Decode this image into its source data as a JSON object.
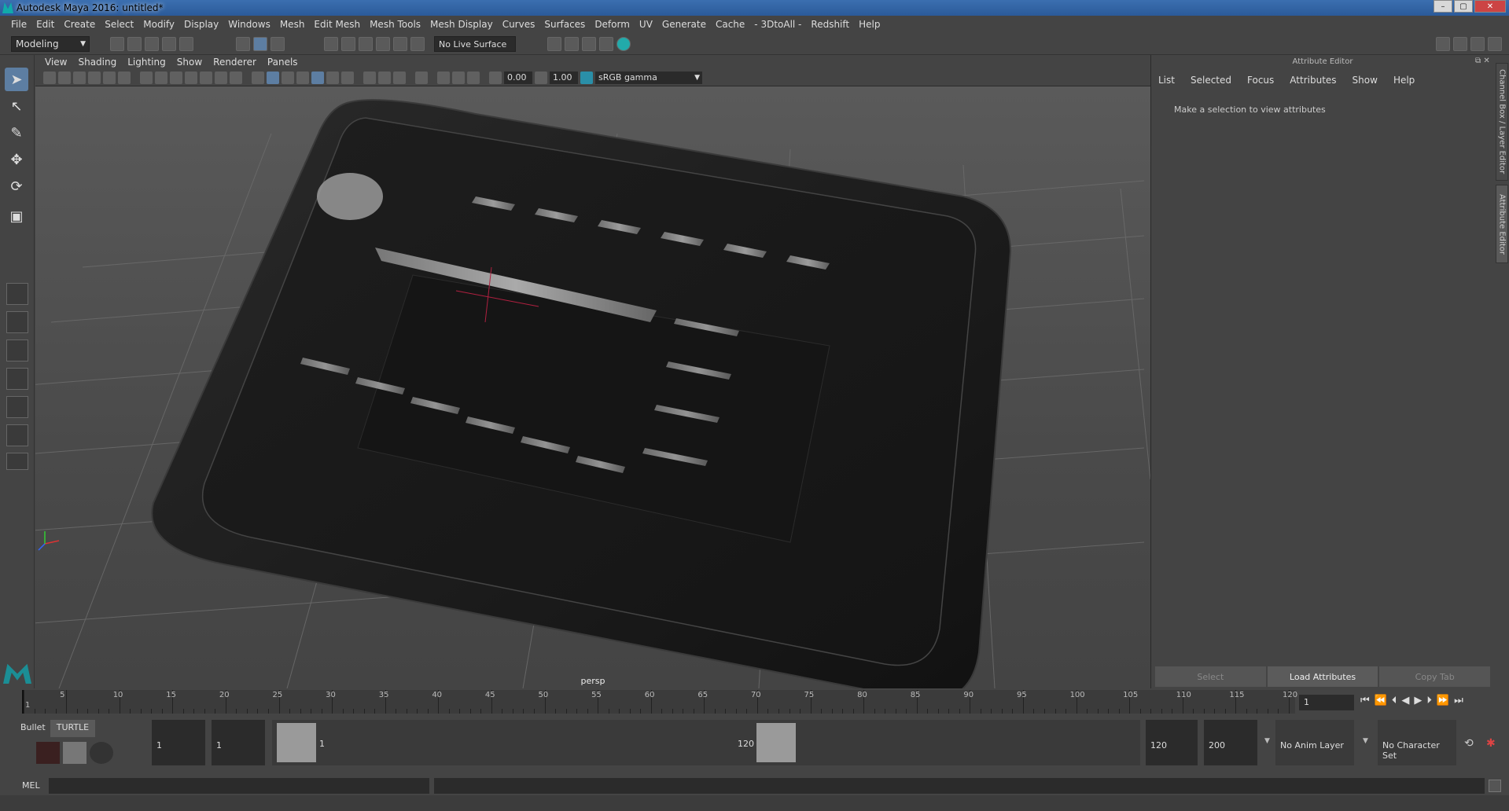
{
  "window": {
    "title": "Autodesk Maya 2016: untitled*"
  },
  "menu": [
    "File",
    "Edit",
    "Create",
    "Select",
    "Modify",
    "Display",
    "Windows",
    "Mesh",
    "Edit Mesh",
    "Mesh Tools",
    "Mesh Display",
    "Curves",
    "Surfaces",
    "Deform",
    "UV",
    "Generate",
    "Cache",
    "- 3DtoAll -",
    "Redshift",
    "Help"
  ],
  "shelf": {
    "mode": "Modeling",
    "live_surface": "No Live Surface"
  },
  "viewport": {
    "menu": [
      "View",
      "Shading",
      "Lighting",
      "Show",
      "Renderer",
      "Panels"
    ],
    "exposure": "0.00",
    "gamma": "1.00",
    "colorspace": "sRGB gamma",
    "camera_label": "persp"
  },
  "attribute_editor": {
    "title": "Attribute Editor",
    "menu": [
      "List",
      "Selected",
      "Focus",
      "Attributes",
      "Show",
      "Help"
    ],
    "message": "Make a selection to view attributes",
    "buttons": {
      "select": "Select",
      "load": "Load Attributes",
      "copy": "Copy Tab"
    },
    "side_tabs": [
      "Channel Box / Layer Editor",
      "Attribute Editor"
    ]
  },
  "timeline": {
    "ticks": [
      "1",
      "5",
      "10",
      "15",
      "20",
      "25",
      "30",
      "35",
      "40",
      "45",
      "50",
      "55",
      "60",
      "65",
      "70",
      "75",
      "80",
      "85",
      "90",
      "95",
      "100",
      "105",
      "110",
      "115",
      "120"
    ],
    "current_frame": "1"
  },
  "range": {
    "shelf_tabs": [
      "Bullet",
      "TURTLE"
    ],
    "start": "1",
    "playback_start": "1",
    "slider_start_label": "1",
    "slider_end_label": "120",
    "playback_end": "120",
    "end": "200",
    "anim_layer": "No Anim Layer",
    "character_set": "No Character Set"
  },
  "command_line": {
    "label": "MEL"
  }
}
